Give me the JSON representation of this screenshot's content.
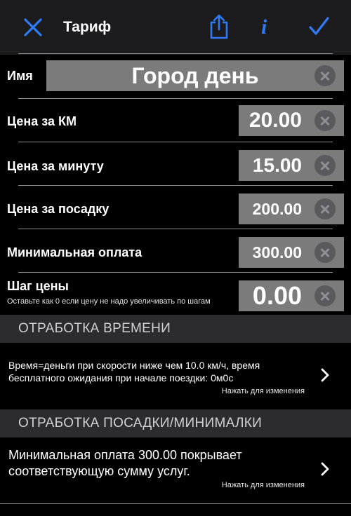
{
  "header": {
    "title": "Тариф",
    "close_icon": "close-icon",
    "share_icon": "share-icon",
    "info_label": "i",
    "done_icon": "checkmark-icon",
    "accent_color": "#2f7bf5"
  },
  "form": {
    "name": {
      "label": "Имя",
      "value": "Город день"
    },
    "price_km": {
      "label": "Цена за КМ",
      "value": "20.00"
    },
    "price_minute": {
      "label": "Цена за минуту",
      "value": "15.00"
    },
    "price_boarding": {
      "label": "Цена за посадку",
      "value": "200.00"
    },
    "min_payment": {
      "label": "Минимальная оплата",
      "value": "300.00"
    },
    "price_step": {
      "label": "Шаг цены",
      "value": "0.00",
      "hint": "Оставьте как 0 если цену не надо увеличивать по шагам"
    }
  },
  "sections": [
    {
      "title": "ОТРАБОТКА ВРЕМЕНИ",
      "row_text_line1": "Время=деньги при скорости ниже чем 10.0 км/ч, время",
      "row_text_line2": "бесплатного ожидания при начале поездки: 0м0с",
      "row_action": "Нажать для изменения"
    },
    {
      "title": "ОТРАБОТКА ПОСАДКИ/МИНИМАЛКИ",
      "row_text_line1": "Минимальная оплата 300.00 покрывает",
      "row_text_line2": "соответствующую сумму услуг.",
      "row_action": "Нажать для изменения"
    }
  ]
}
